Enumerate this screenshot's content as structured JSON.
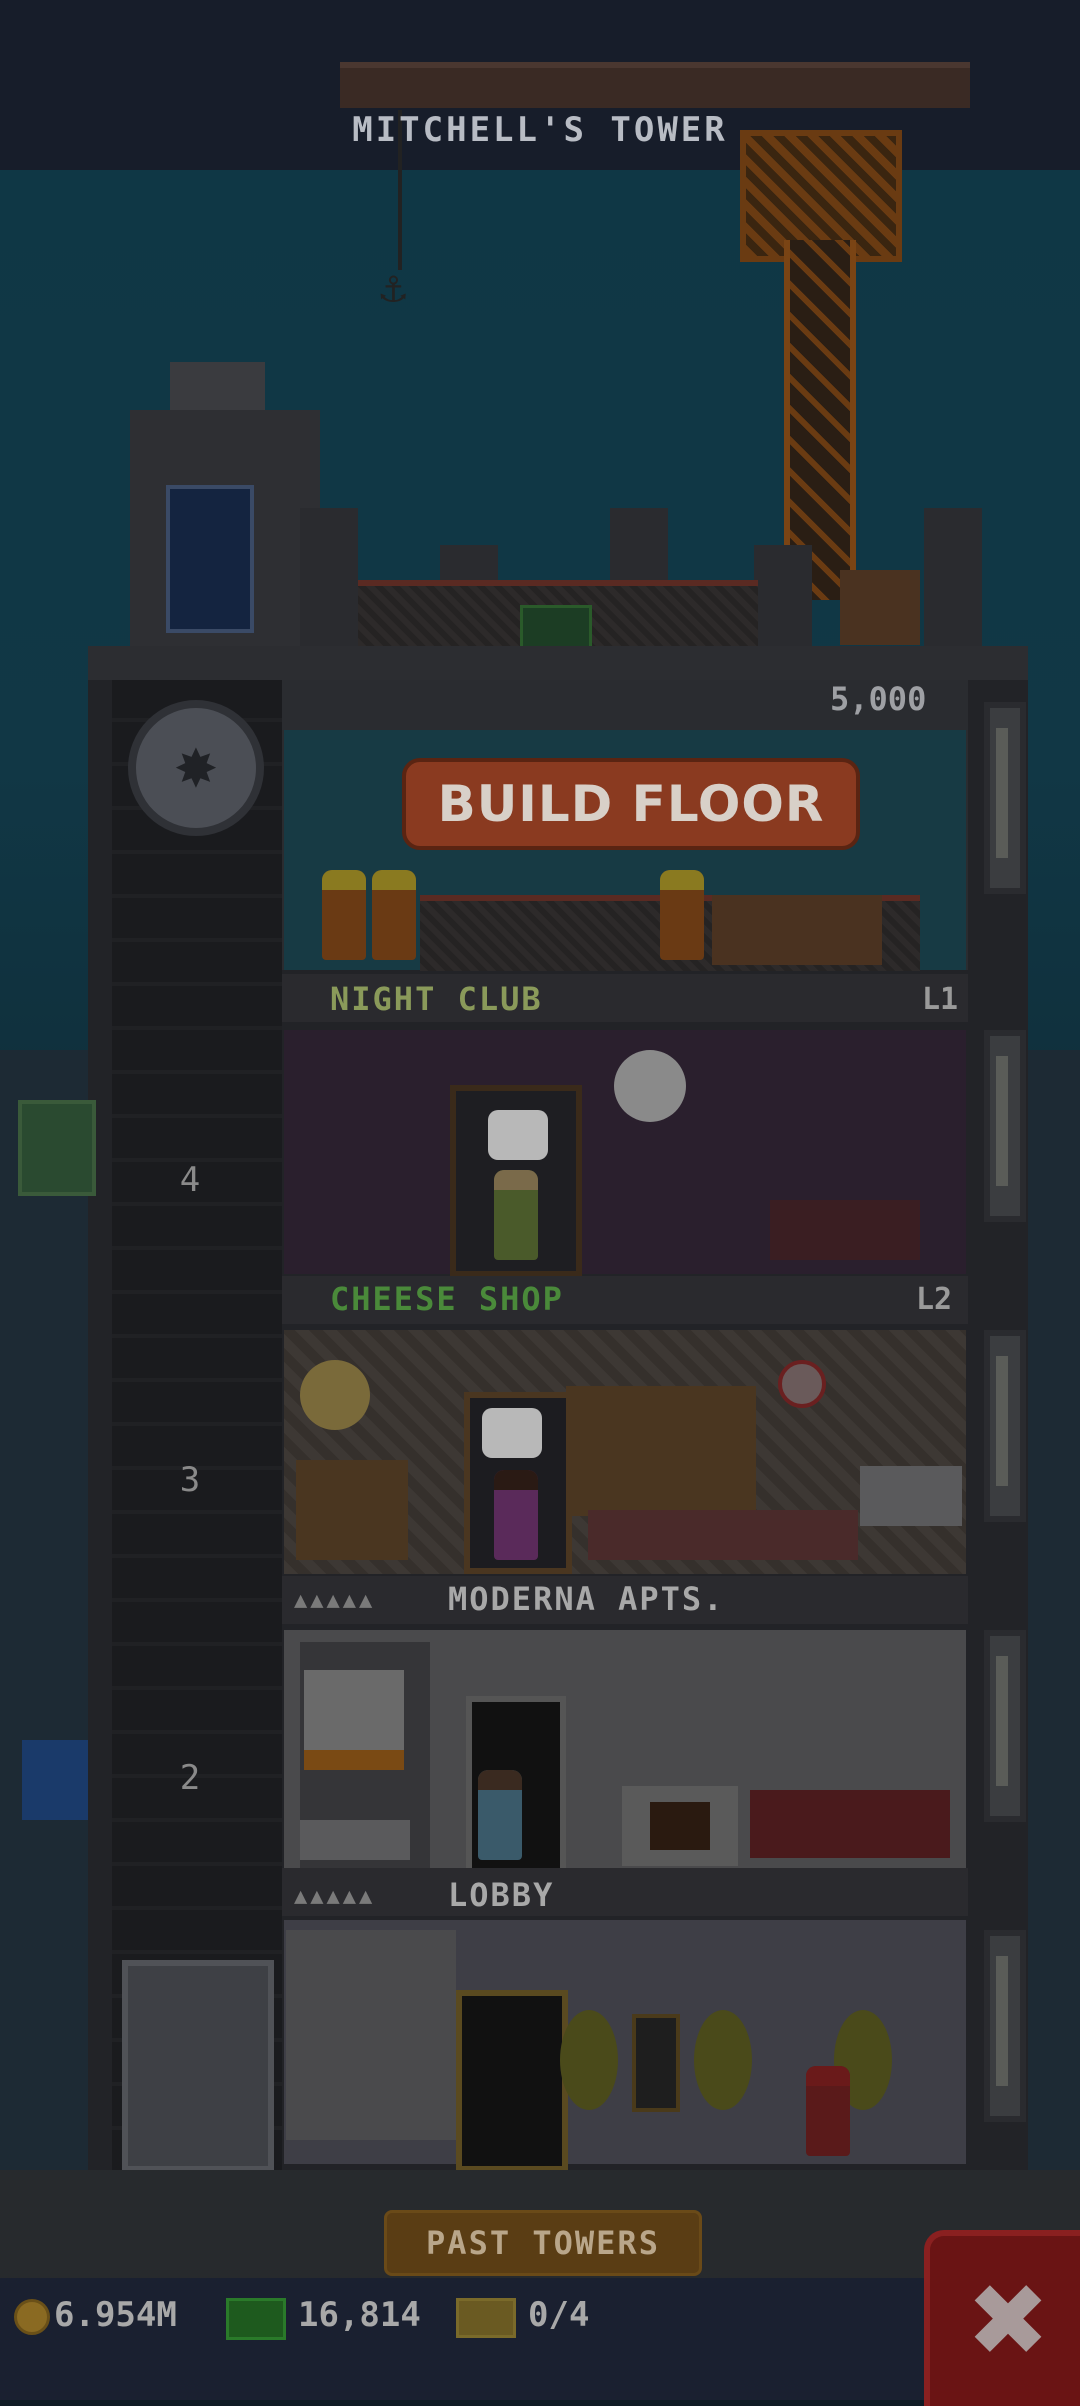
{
  "header": {
    "tower_name": "MITCHELL'S TOWER"
  },
  "build": {
    "cost": "5,000",
    "button_label": "BUILD FLOOR"
  },
  "floors": [
    {
      "name": "NIGHT CLUB",
      "level": "L1",
      "color": "#8a9a5a"
    },
    {
      "name": "CHEESE SHOP",
      "level": "L2",
      "color": "#4a8a3a"
    },
    {
      "name": "MODERNA APTS.",
      "level": "",
      "color": "#a8a8a8"
    },
    {
      "name": "LOBBY",
      "level": "",
      "color": "#a8a8a8"
    }
  ],
  "elevator": {
    "floor_numbers": [
      "4",
      "3",
      "2"
    ]
  },
  "bottom": {
    "past_towers_label": "PAST TOWERS"
  },
  "status": {
    "coins": "6.954M",
    "bux": "16,814",
    "tickets": "0/4"
  },
  "icons": {
    "coin": "coin-icon",
    "bux": "bux-icon",
    "ticket": "ticket-icon",
    "close": "close-icon"
  }
}
